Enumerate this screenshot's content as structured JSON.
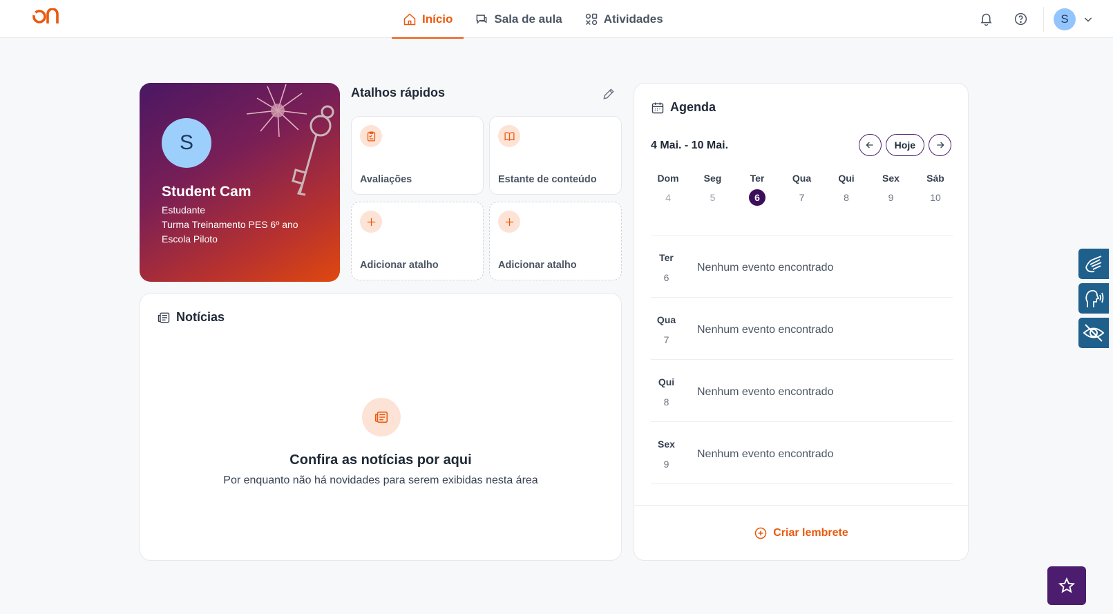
{
  "nav": {
    "items": [
      {
        "label": "Início",
        "icon": "home-icon",
        "active": true
      },
      {
        "label": "Sala de aula",
        "icon": "chat-icon",
        "active": false
      },
      {
        "label": "Atividades",
        "icon": "shapes-icon",
        "active": false
      }
    ],
    "user_initial": "S"
  },
  "profile": {
    "initial": "S",
    "name": "Student Cam",
    "role": "Estudante",
    "class": "Turma Treinamento PES 6º ano",
    "school": "Escola Piloto"
  },
  "shortcuts": {
    "title": "Atalhos rápidos",
    "items": [
      {
        "label": "Avaliações",
        "icon": "clipboard-icon"
      },
      {
        "label": "Estante de conteúdo",
        "icon": "book-icon"
      },
      {
        "label": "Adicionar atalho",
        "icon": "plus-icon"
      },
      {
        "label": "Adicionar atalho",
        "icon": "plus-icon"
      }
    ]
  },
  "news": {
    "title": "Notícias",
    "empty_title": "Confira as notícias por aqui",
    "empty_subtitle": "Por enquanto não há novidades para serem exibidas nesta área"
  },
  "agenda": {
    "title": "Agenda",
    "range": "4 Mai. - 10 Mai.",
    "today_label": "Hoje",
    "week": [
      {
        "name": "Dom",
        "date": "4"
      },
      {
        "name": "Seg",
        "date": "5"
      },
      {
        "name": "Ter",
        "date": "6"
      },
      {
        "name": "Qua",
        "date": "7"
      },
      {
        "name": "Qui",
        "date": "8"
      },
      {
        "name": "Sex",
        "date": "9"
      },
      {
        "name": "Sáb",
        "date": "10"
      }
    ],
    "events": [
      {
        "day": "Ter",
        "date": "6",
        "text": "Nenhum evento encontrado"
      },
      {
        "day": "Qua",
        "date": "7",
        "text": "Nenhum evento encontrado"
      },
      {
        "day": "Qui",
        "date": "8",
        "text": "Nenhum evento encontrado"
      },
      {
        "day": "Sex",
        "date": "9",
        "text": "Nenhum evento encontrado"
      }
    ],
    "create_label": "Criar lembrete"
  },
  "colors": {
    "accent": "#ea580c",
    "brand_purple": "#4c1d6e",
    "a11y_blue": "#1f5f8b"
  }
}
